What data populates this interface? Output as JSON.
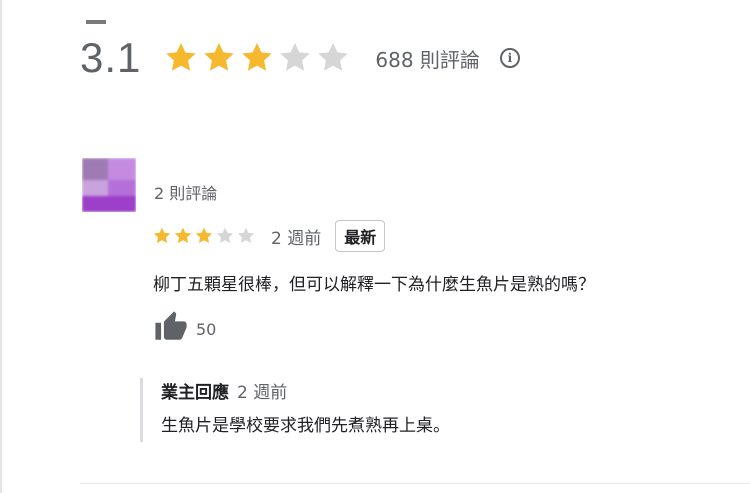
{
  "summary": {
    "rating": "3.1",
    "stars_filled": 3,
    "stars_total": 5,
    "review_count_text": "688 則評論",
    "info_icon": "info-icon"
  },
  "review": {
    "avatar": "blurred-avatar",
    "author_meta": "2 則評論",
    "stars_filled": 3,
    "stars_total": 5,
    "time": "2 週前",
    "badge": "最新",
    "text": "柳丁五顆星很棒，但可以解釋一下為什麼生魚片是熟的嗎？",
    "like_icon": "thumbs-up-icon",
    "likes": "50"
  },
  "owner_reply": {
    "author": "業主回應",
    "time": "2 週前",
    "text": "生魚片是學校要求我們先煮熟再上桌。"
  },
  "colors": {
    "star_filled": "#f5b82e",
    "star_empty": "#d6d6d6",
    "text_secondary": "#5f6368",
    "text_primary": "#202124",
    "reply_border": "#dadce0",
    "avatar_purple": "#a65ad1"
  }
}
